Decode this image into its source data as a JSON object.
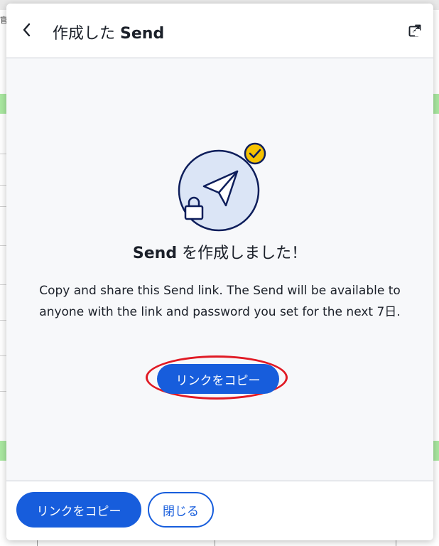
{
  "background": {
    "corner_text": "官"
  },
  "header": {
    "title_prefix": "作成した",
    "title_send": "Send",
    "back_icon": "chevron-left-icon",
    "popout_icon": "popout-icon"
  },
  "main": {
    "illustration_icons": [
      "paper-plane-icon",
      "lock-icon",
      "check-badge-icon"
    ],
    "headline_send": "Send",
    "headline_rest": "を作成しました！",
    "description": "Copy and share this Send link. The Send will be available to anyone with the link and password you set for the next 7日.",
    "copy_button_label": "リンクをコピー"
  },
  "footer": {
    "copy_button_label": "リンクをコピー",
    "close_button_label": "閉じる"
  },
  "colors": {
    "primary": "#175ddc",
    "highlight": "#e01a24",
    "check_badge": "#f6c200",
    "illustration_fill": "#dbe5f6",
    "ink": "#0e1e5b"
  }
}
